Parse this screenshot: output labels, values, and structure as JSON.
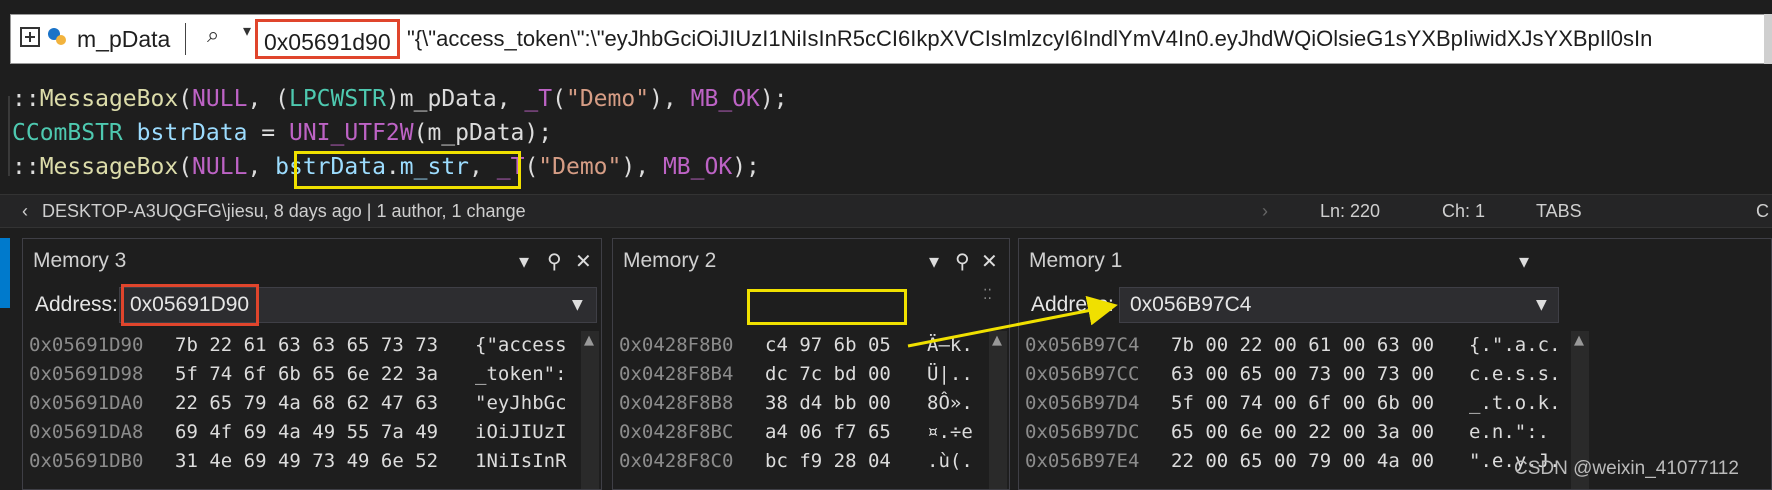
{
  "datatip": {
    "variable": "m_pData",
    "address": "0x05691d90",
    "value": "\"{\\\"access_token\\\":\\\"eyJhbGciOiJIUzI1NiIsInR5cCI6IkpXVCIsImlzcyI6IndlYmV4In0.eyJhdWQiOlsieG1sYXBpIiwidXJsYXBpIl0sIn"
  },
  "code": {
    "line1": [
      {
        "t": "::",
        "c": "op"
      },
      {
        "t": "MessageBox",
        "c": "fn"
      },
      {
        "t": "(",
        "c": "op"
      },
      {
        "t": "NULL",
        "c": "mac"
      },
      {
        "t": ", (",
        "c": "op"
      },
      {
        "t": "LPCWSTR",
        "c": "ty"
      },
      {
        "t": ")",
        "c": "op"
      },
      {
        "t": "m_pData",
        "c": "op"
      },
      {
        "t": ", ",
        "c": "op"
      },
      {
        "t": "_T",
        "c": "mac"
      },
      {
        "t": "(",
        "c": "op"
      },
      {
        "t": "\"Demo\"",
        "c": "str"
      },
      {
        "t": "), ",
        "c": "op"
      },
      {
        "t": "MB_OK",
        "c": "mac"
      },
      {
        "t": ");",
        "c": "op"
      }
    ],
    "line2": [
      {
        "t": "CComBSTR",
        "c": "ty"
      },
      {
        "t": " ",
        "c": "op"
      },
      {
        "t": "bstrData",
        "c": "var"
      },
      {
        "t": " = ",
        "c": "op"
      },
      {
        "t": "UNI_UTF2W",
        "c": "mac"
      },
      {
        "t": "(",
        "c": "op"
      },
      {
        "t": "m_pData",
        "c": "op"
      },
      {
        "t": ");",
        "c": "op"
      }
    ],
    "line3": [
      {
        "t": "::",
        "c": "op"
      },
      {
        "t": "MessageBox",
        "c": "fn"
      },
      {
        "t": "(",
        "c": "op"
      },
      {
        "t": "NULL",
        "c": "mac"
      },
      {
        "t": ", ",
        "c": "op"
      },
      {
        "t": "bstrData",
        "c": "var"
      },
      {
        "t": ".",
        "c": "op"
      },
      {
        "t": "m_str",
        "c": "var"
      },
      {
        "t": ", ",
        "c": "op"
      },
      {
        "t": "_T",
        "c": "mac"
      },
      {
        "t": "(",
        "c": "op"
      },
      {
        "t": "\"Demo\"",
        "c": "str"
      },
      {
        "t": "), ",
        "c": "op"
      },
      {
        "t": "MB_OK",
        "c": "mac"
      },
      {
        "t": ");",
        "c": "op"
      }
    ]
  },
  "status": {
    "blame": "DESKTOP-A3UQGFG\\jiesu, 8 days ago | 1 author, 1 change",
    "ln": "Ln: 220",
    "ch": "Ch: 1",
    "tabs": "TABS",
    "cut": "C"
  },
  "memory3": {
    "title": "Memory 3",
    "address_label": "Address:",
    "address": "0x05691D90",
    "rows": [
      {
        "addr": "0x05691D90",
        "hex": "7b 22 61 63 63 65 73 73",
        "text": "{\"access"
      },
      {
        "addr": "0x05691D98",
        "hex": "5f 74 6f 6b 65 6e 22 3a",
        "text": "_token\":"
      },
      {
        "addr": "0x05691DA0",
        "hex": "22 65 79 4a 68 62 47 63",
        "text": "\"eyJhbGc"
      },
      {
        "addr": "0x05691DA8",
        "hex": "69 4f 69 4a 49 55 7a 49",
        "text": "iOiJIUzI"
      },
      {
        "addr": "0x05691DB0",
        "hex": "31 4e 69 49 73 49 6e 52",
        "text": "1NiIsInR"
      }
    ]
  },
  "memory2": {
    "title": "Memory 2",
    "rows": [
      {
        "addr": "0x0428F8B0",
        "hex": "c4 97 6b 05",
        "text": "Ä—k."
      },
      {
        "addr": "0x0428F8B4",
        "hex": "dc 7c bd 00",
        "text": "Ü|.."
      },
      {
        "addr": "0x0428F8B8",
        "hex": "38 d4 bb 00",
        "text": "8Ô»."
      },
      {
        "addr": "0x0428F8BC",
        "hex": "a4 06 f7 65",
        "text": "¤.÷e"
      },
      {
        "addr": "0x0428F8C0",
        "hex": "bc f9 28 04",
        "text": ".ù(."
      }
    ]
  },
  "memory1": {
    "title": "Memory 1",
    "address_label": "Address:",
    "address": "0x056B97C4",
    "rows": [
      {
        "addr": "0x056B97C4",
        "hex": "7b 00 22 00 61 00 63 00",
        "text": "{.\".a.c."
      },
      {
        "addr": "0x056B97CC",
        "hex": "63 00 65 00 73 00 73 00",
        "text": "c.e.s.s."
      },
      {
        "addr": "0x056B97D4",
        "hex": "5f 00 74 00 6f 00 6b 00",
        "text": "_.t.o.k."
      },
      {
        "addr": "0x056B97DC",
        "hex": "65 00 6e 00 22 00 3a 00",
        "text": "e.n.\":."
      },
      {
        "addr": "0x056B97E4",
        "hex": "22 00 65 00 79 00 4a 00",
        "text": "\".e.y.J."
      }
    ]
  },
  "watermark": "CSDN @weixin_41077112",
  "colors": {
    "red_box": "#e0452c",
    "yellow_box": "#f0e000",
    "arrow": "#f0e000"
  }
}
